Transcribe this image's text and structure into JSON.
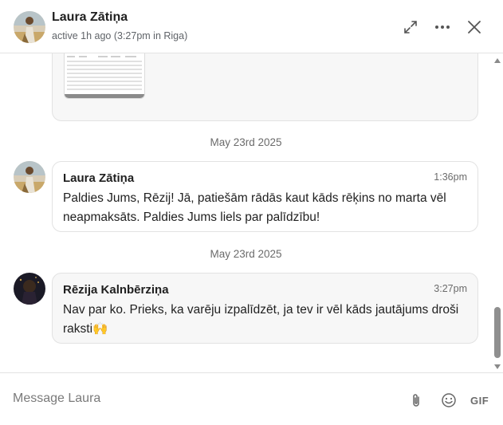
{
  "header": {
    "name": "Laura Zātiņa",
    "status": "active 1h ago (3:27pm in Riga)",
    "icons": [
      "expand-icon",
      "more-icon",
      "close-icon"
    ]
  },
  "messages": [
    {
      "type": "attachment",
      "preview": "spreadsheet-thumbnail"
    },
    {
      "date_separator": "May 23rd 2025",
      "sender": "Laura Zātiņa",
      "time": "1:36pm",
      "text": "Paldies Jums, Rēzij! Jā, patiešām rādās kaut kāds rēķins no marta vēl neapmaksāts. Paldies Jums liels par palīdzību!"
    },
    {
      "date_separator": "May 23rd 2025",
      "sender": "Rēzija Kalnbērziņa",
      "time": "3:27pm",
      "text": "Nav par ko. Prieks, ka varēju izpalīdzēt, ja tev ir vēl kāds jautājums droši raksti🙌"
    }
  ],
  "composer": {
    "placeholder": "Message Laura",
    "gif_label": "GIF",
    "icons": [
      "attachment-icon",
      "emoji-icon"
    ]
  },
  "colors": {
    "bubble_bg": "#f7f7f7",
    "border": "#e2e2e2",
    "muted_text": "#6b6b6b"
  }
}
